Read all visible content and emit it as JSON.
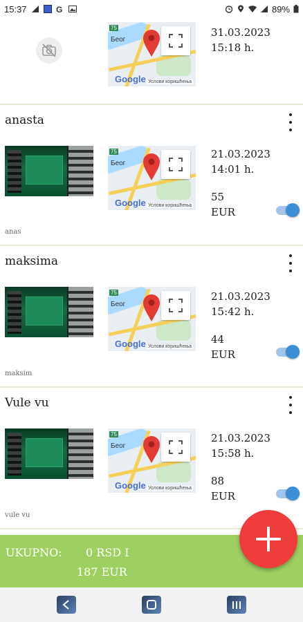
{
  "status_bar": {
    "time": "15:37",
    "battery": "89%",
    "left_icons": [
      "signal-x-icon",
      "app-icon",
      "g-icon",
      "image-icon"
    ],
    "right_icons": [
      "alarm-icon",
      "location-icon",
      "wifi-icon",
      "cell-signal-icon"
    ]
  },
  "entries": [
    {
      "title": "",
      "has_photo": false,
      "date": "31.03.2023",
      "time": "15:18 h.",
      "amount": "",
      "currency": "",
      "toggle_on": null,
      "note": ""
    },
    {
      "title": "anasta",
      "has_photo": true,
      "date": "21.03.2023",
      "time": "14:01 h.",
      "amount": "55",
      "currency": "EUR",
      "toggle_on": true,
      "note": "anas"
    },
    {
      "title": "maksima",
      "has_photo": true,
      "date": "21.03.2023",
      "time": "15:42 h.",
      "amount": "44",
      "currency": "EUR",
      "toggle_on": true,
      "note": "maksim"
    },
    {
      "title": "Vule vu",
      "has_photo": true,
      "date": "21.03.2023",
      "time": "15:58 h.",
      "amount": "88",
      "currency": "EUR",
      "toggle_on": true,
      "note": "vule vu"
    }
  ],
  "map": {
    "city_label": "Беог",
    "road_shield": "75",
    "logo": "Google",
    "terms": "Услови коришћења"
  },
  "total": {
    "label": "UKUPNO:",
    "rsd": "0 RSD I",
    "eur": "187 EUR"
  },
  "colors": {
    "total_bar": "#9dd061",
    "fab": "#ef3b3a",
    "toggle": "#3b8fd6"
  }
}
